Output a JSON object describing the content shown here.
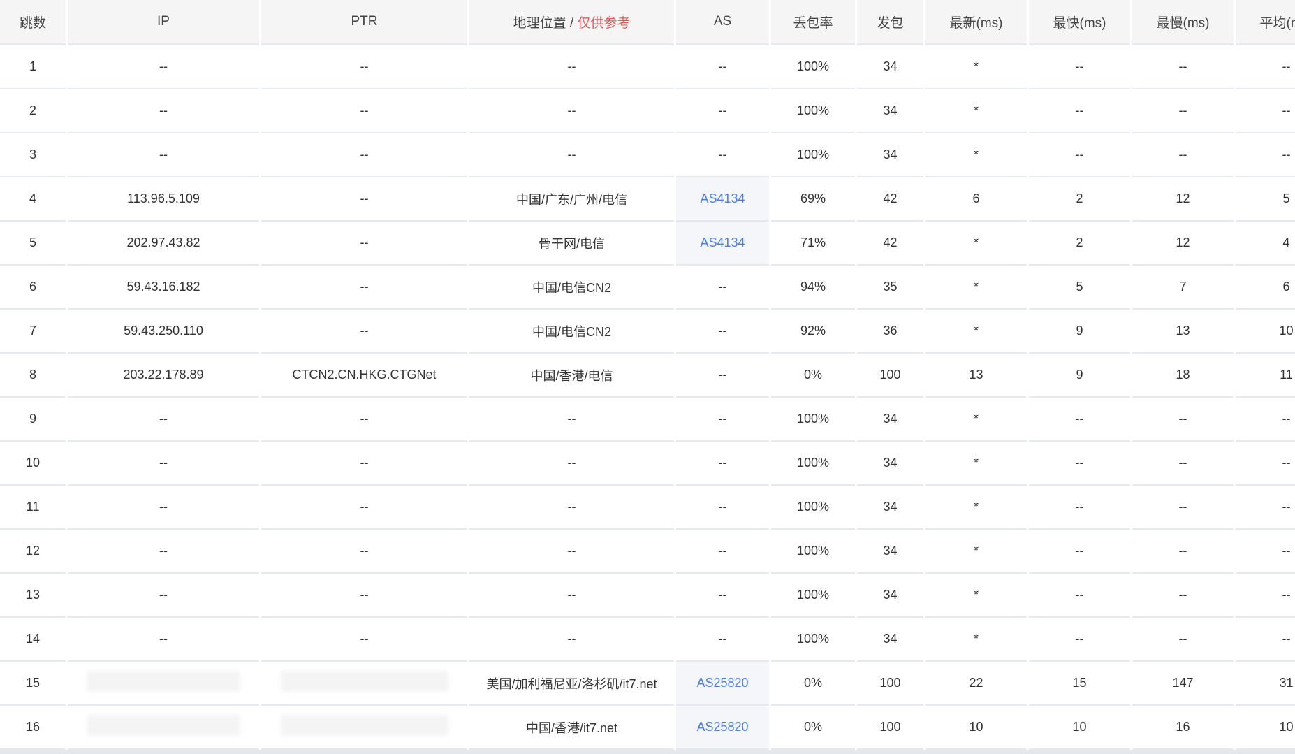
{
  "headers": {
    "hop": "跳数",
    "ip": "IP",
    "ptr": "PTR",
    "geo": "地理位置",
    "geo_sep": " / ",
    "geo_note": "仅供参考",
    "as": "AS",
    "loss": "丢包率",
    "sent": "发包",
    "last": "最新(ms)",
    "best": "最快(ms)",
    "worst": "最慢(ms)",
    "avg": "平均(ms)"
  },
  "rows": [
    {
      "hop": "1",
      "ip": "--",
      "ptr": "--",
      "geo": "--",
      "as": "--",
      "loss": "100%",
      "sent": "34",
      "last": "*",
      "best": "--",
      "worst": "--",
      "avg": "--"
    },
    {
      "hop": "2",
      "ip": "--",
      "ptr": "--",
      "geo": "--",
      "as": "--",
      "loss": "100%",
      "sent": "34",
      "last": "*",
      "best": "--",
      "worst": "--",
      "avg": "--"
    },
    {
      "hop": "3",
      "ip": "--",
      "ptr": "--",
      "geo": "--",
      "as": "--",
      "loss": "100%",
      "sent": "34",
      "last": "*",
      "best": "--",
      "worst": "--",
      "avg": "--"
    },
    {
      "hop": "4",
      "ip": "113.96.5.109",
      "ptr": "--",
      "geo": "中国/广东/广州/电信",
      "as": "AS4134",
      "loss": "69%",
      "sent": "42",
      "last": "6",
      "best": "2",
      "worst": "12",
      "avg": "5"
    },
    {
      "hop": "5",
      "ip": "202.97.43.82",
      "ptr": "--",
      "geo": "骨干网/电信",
      "as": "AS4134",
      "loss": "71%",
      "sent": "42",
      "last": "*",
      "best": "2",
      "worst": "12",
      "avg": "4"
    },
    {
      "hop": "6",
      "ip": "59.43.16.182",
      "ptr": "--",
      "geo": "中国/电信CN2",
      "as": "--",
      "loss": "94%",
      "sent": "35",
      "last": "*",
      "best": "5",
      "worst": "7",
      "avg": "6"
    },
    {
      "hop": "7",
      "ip": "59.43.250.110",
      "ptr": "--",
      "geo": "中国/电信CN2",
      "as": "--",
      "loss": "92%",
      "sent": "36",
      "last": "*",
      "best": "9",
      "worst": "13",
      "avg": "10"
    },
    {
      "hop": "8",
      "ip": "203.22.178.89",
      "ptr": "CTCN2.CN.HKG.CTGNet",
      "geo": "中国/香港/电信",
      "as": "--",
      "loss": "0%",
      "sent": "100",
      "last": "13",
      "best": "9",
      "worst": "18",
      "avg": "11"
    },
    {
      "hop": "9",
      "ip": "--",
      "ptr": "--",
      "geo": "--",
      "as": "--",
      "loss": "100%",
      "sent": "34",
      "last": "*",
      "best": "--",
      "worst": "--",
      "avg": "--"
    },
    {
      "hop": "10",
      "ip": "--",
      "ptr": "--",
      "geo": "--",
      "as": "--",
      "loss": "100%",
      "sent": "34",
      "last": "*",
      "best": "--",
      "worst": "--",
      "avg": "--"
    },
    {
      "hop": "11",
      "ip": "--",
      "ptr": "--",
      "geo": "--",
      "as": "--",
      "loss": "100%",
      "sent": "34",
      "last": "*",
      "best": "--",
      "worst": "--",
      "avg": "--"
    },
    {
      "hop": "12",
      "ip": "--",
      "ptr": "--",
      "geo": "--",
      "as": "--",
      "loss": "100%",
      "sent": "34",
      "last": "*",
      "best": "--",
      "worst": "--",
      "avg": "--"
    },
    {
      "hop": "13",
      "ip": "--",
      "ptr": "--",
      "geo": "--",
      "as": "--",
      "loss": "100%",
      "sent": "34",
      "last": "*",
      "best": "--",
      "worst": "--",
      "avg": "--"
    },
    {
      "hop": "14",
      "ip": "--",
      "ptr": "--",
      "geo": "--",
      "as": "--",
      "loss": "100%",
      "sent": "34",
      "last": "*",
      "best": "--",
      "worst": "--",
      "avg": "--"
    },
    {
      "hop": "15",
      "ip": null,
      "ptr": null,
      "geo": "美国/加利福尼亚/洛杉矶/it7.net",
      "as": "AS25820",
      "loss": "0%",
      "sent": "100",
      "last": "22",
      "best": "15",
      "worst": "147",
      "avg": "31"
    },
    {
      "hop": "16",
      "ip": null,
      "ptr": null,
      "geo": "中国/香港/it7.net",
      "as": "AS25820",
      "loss": "0%",
      "sent": "100",
      "last": "10",
      "best": "10",
      "worst": "16",
      "avg": "10"
    }
  ]
}
